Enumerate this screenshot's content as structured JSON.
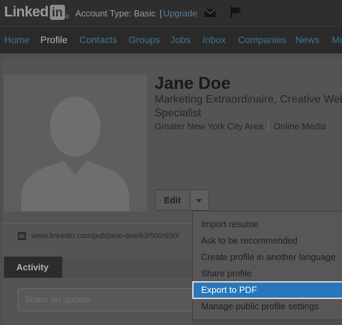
{
  "header": {
    "logo_text": "Linked",
    "logo_in": "in",
    "logo_reg": "®",
    "account_label": "Account Type: Basic",
    "account_sep": "|",
    "upgrade_label": "Upgrade",
    "icons": [
      "mail-icon",
      "flag-icon"
    ]
  },
  "nav": {
    "items": [
      {
        "label": "Home"
      },
      {
        "label": "Profile",
        "active": true
      },
      {
        "label": "Contacts"
      },
      {
        "label": "Groups"
      },
      {
        "label": "Jobs"
      },
      {
        "label": "Inbox"
      },
      {
        "label": "Companies"
      },
      {
        "label": "News"
      },
      {
        "label": "Mo"
      }
    ]
  },
  "profile": {
    "name": "Jane Doe",
    "headline": "Marketing Extraordinaire, Creative Web Specialist",
    "location": "Greater New York City Area",
    "industry": "Online Media",
    "edit_label": "Edit",
    "public_url": "www.linkedin.com/pub/jane-doe/63/500/650/"
  },
  "edit_menu": {
    "items": [
      {
        "label": "Import resume"
      },
      {
        "label": "Ask to be recommended"
      },
      {
        "label": "Create profile in another language"
      },
      {
        "label": "Share profile"
      },
      {
        "label": "Export to PDF",
        "selected": true
      },
      {
        "label": "Manage public profile settings"
      }
    ]
  },
  "activity": {
    "tab_label": "Activity",
    "share_placeholder": "Share an update..."
  },
  "colors": {
    "link": "#3f7394",
    "selected_item": "#2977b8"
  }
}
